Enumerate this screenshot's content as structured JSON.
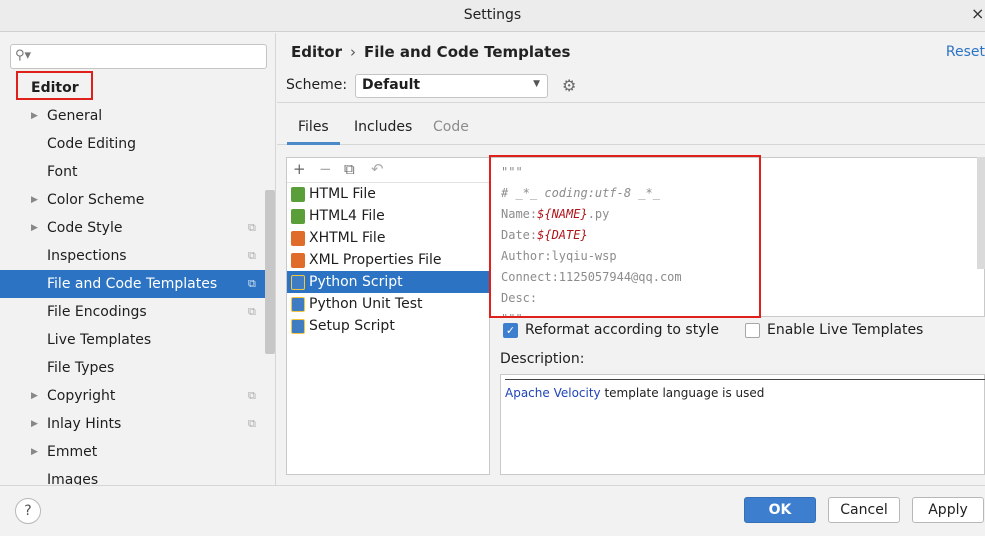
{
  "window": {
    "title": "Settings",
    "close_glyph": "×"
  },
  "sidebar": {
    "search": {
      "placeholder": "",
      "value": ""
    },
    "root": "Editor",
    "items": [
      {
        "label": "General",
        "expandable": true,
        "project": false
      },
      {
        "label": "Code Editing",
        "expandable": false,
        "project": false
      },
      {
        "label": "Font",
        "expandable": false,
        "project": false
      },
      {
        "label": "Color Scheme",
        "expandable": true,
        "project": false
      },
      {
        "label": "Code Style",
        "expandable": true,
        "project": true
      },
      {
        "label": "Inspections",
        "expandable": false,
        "project": true
      },
      {
        "label": "File and Code Templates",
        "expandable": false,
        "project": true,
        "selected": true
      },
      {
        "label": "File Encodings",
        "expandable": false,
        "project": true
      },
      {
        "label": "Live Templates",
        "expandable": false,
        "project": false
      },
      {
        "label": "File Types",
        "expandable": false,
        "project": false
      },
      {
        "label": "Copyright",
        "expandable": true,
        "project": true
      },
      {
        "label": "Inlay Hints",
        "expandable": true,
        "project": true
      },
      {
        "label": "Emmet",
        "expandable": true,
        "project": false
      },
      {
        "label": "Images",
        "expandable": false,
        "project": false
      }
    ]
  },
  "header": {
    "breadcrumb": [
      "Editor",
      "File and Code Templates"
    ],
    "reset": "Reset"
  },
  "scheme": {
    "label": "Scheme:",
    "value": "Default"
  },
  "tabs": [
    {
      "label": "Files",
      "active": true
    },
    {
      "label": "Includes",
      "active": false
    },
    {
      "label": "Code",
      "active": false,
      "disabled": true
    }
  ],
  "files": [
    {
      "name": "HTML File",
      "icon": "html-file-icon",
      "color": "#5a9e3a"
    },
    {
      "name": "HTML4 File",
      "icon": "html-file-icon",
      "color": "#5a9e3a"
    },
    {
      "name": "XHTML File",
      "icon": "xhtml-file-icon",
      "color": "#e06c2c"
    },
    {
      "name": "XML Properties File",
      "icon": "xml-file-icon",
      "color": "#e06c2c"
    },
    {
      "name": "Python Script",
      "icon": "python-file-icon",
      "color": "#3f7cc1",
      "selected": true
    },
    {
      "name": "Python Unit Test",
      "icon": "python-file-icon",
      "color": "#3f7cc1"
    },
    {
      "name": "Setup Script",
      "icon": "python-file-icon",
      "color": "#3f7cc1"
    }
  ],
  "code_lines": [
    "\"\"\"",
    "# _*_ coding:utf-8 _*_",
    "Name:",
    "${NAME}",
    ".py",
    "Date:",
    "${DATE}",
    "Author:lyqiu-wsp",
    "Connect:1125057944@qq.com",
    "Desc:",
    "\"\"\""
  ],
  "options": {
    "reformat": {
      "label": "Reformat according to style",
      "checked": true
    },
    "live_templates": {
      "label": "Enable Live Templates",
      "checked": false
    }
  },
  "description": {
    "label": "Description:",
    "link": "Apache Velocity",
    "text": " template language is used"
  },
  "buttons": {
    "ok": "OK",
    "cancel": "Cancel",
    "apply": "Apply",
    "help": "?"
  },
  "colors": {
    "accent": "#2c74c3",
    "highlight_box": "#e0201b",
    "template_var": "#b0141b"
  }
}
